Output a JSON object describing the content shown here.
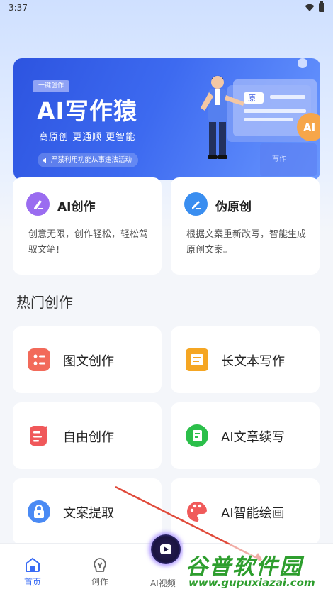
{
  "status_bar": {
    "time": "3:37"
  },
  "banner": {
    "tag": "一键创作",
    "title": "AI写作猿",
    "subtitle": "高原创 更通顺 更智能",
    "notice": "严禁利用功能从事违法活动",
    "art_doc_label": "原",
    "art_ai_badge": "AI",
    "art_caption": "写作",
    "colors": {
      "start": "#2d54e0",
      "end": "#6a98ff"
    }
  },
  "features": [
    {
      "icon": "pen-icon",
      "title": "AI创作",
      "desc": "创意无限，创作轻松，轻松驾驭文笔!",
      "color": "#9a6cf0"
    },
    {
      "icon": "edit-icon",
      "title": "伪原创",
      "desc": "根据文案重新改写，智能生成原创文案。",
      "color": "#3a8ef0"
    }
  ],
  "hot_section": {
    "title": "热门创作"
  },
  "tiles": [
    {
      "label": "图文创作",
      "icon": "image-text-icon",
      "color": "#f26a5a"
    },
    {
      "label": "长文本写作",
      "icon": "long-text-icon",
      "color": "#f5a623"
    },
    {
      "label": "自由创作",
      "icon": "free-write-icon",
      "color": "#f0585a"
    },
    {
      "label": "AI文章续写",
      "icon": "continue-write-icon",
      "color": "#2bbf4a"
    },
    {
      "label": "文案提取",
      "icon": "lock-extract-icon",
      "color": "#4a8af4"
    },
    {
      "label": "AI智能绘画",
      "icon": "palette-icon",
      "color": "#f05a5a"
    }
  ],
  "bottom_nav": {
    "home": "首页",
    "create": "创作",
    "ai_video": "AI视频"
  },
  "watermark": {
    "main": "谷普软件园",
    "sub": "www.gupuxiazai.com"
  }
}
